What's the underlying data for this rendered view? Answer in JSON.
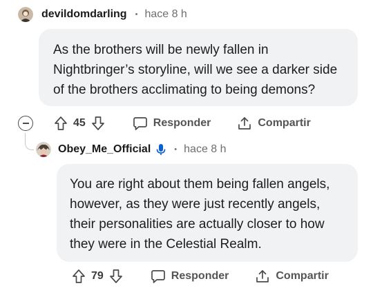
{
  "comments": [
    {
      "username": "devildomdarling",
      "separator": "•",
      "time": "hace 8 h",
      "lines": [
        "As the brothers will be newly fallen in",
        "Nightbringer’s storyline, will we see a darker side",
        "of the brothers acclimating to being demons?"
      ],
      "votes": "45",
      "reply_label": "Responder",
      "share_label": "Compartir"
    },
    {
      "username": "Obey_Me_Official",
      "separator": "•",
      "time": "hace 8 h",
      "lines": [
        "You are right about them being fallen angels,",
        "however, as they were just recently angels,",
        "their personalities are actually closer to how",
        "they were in the Celestial Realm."
      ],
      "votes": "79",
      "reply_label": "Responder",
      "share_label": "Compartir"
    }
  ],
  "colors": {
    "bubble": "#f1f2f4",
    "text": "#1c1c1c",
    "meta": "#6e6e70",
    "action": "#545456",
    "mic_badge": "#0a5fd0"
  },
  "icons": {
    "upvote": "arrow-up-outline",
    "downvote": "arrow-down-outline",
    "reply": "chat-bubble-outline",
    "share": "share-upload-outline",
    "collapse": "minus-circle",
    "mic": "microphone"
  }
}
